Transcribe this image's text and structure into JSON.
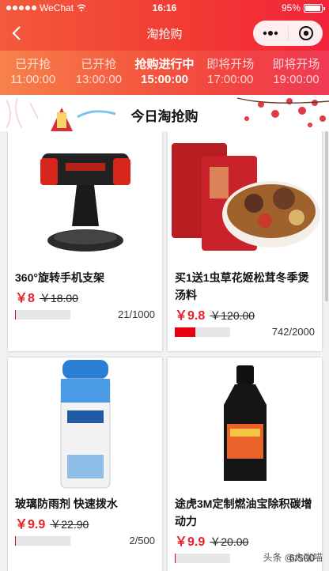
{
  "status_bar": {
    "carrier": "WeChat",
    "time": "16:16",
    "battery": "95%",
    "battery_level": 0.95
  },
  "nav": {
    "title": "淘抢购",
    "back_icon": "chevron-left-icon",
    "more_icon": "more-dots-icon",
    "close_icon": "target-icon"
  },
  "tabs": [
    {
      "name": "已开抢",
      "time": "11:00:00",
      "active": false
    },
    {
      "name": "已开抢",
      "time": "13:00:00",
      "active": false
    },
    {
      "name": "抢购进行中",
      "time": "15:00:00",
      "active": true
    },
    {
      "name": "即将开场",
      "time": "17:00:00",
      "active": false
    },
    {
      "name": "即将开场",
      "time": "19:00:00",
      "active": false
    }
  ],
  "banner": {
    "heading": "今日淘抢购"
  },
  "products": [
    {
      "name": "360°旋转手机支架",
      "price": "￥8",
      "orig": "￥18.00",
      "sold": 21,
      "total": 1000,
      "count": "21/1000",
      "image": "phone-holder-image"
    },
    {
      "name": "买1送1虫草花姬松茸冬季煲汤料",
      "price": "￥9.8",
      "orig": "￥120.00",
      "sold": 742,
      "total": 2000,
      "count": "742/2000",
      "image": "soup-pack-image"
    },
    {
      "name": "玻璃防雨剂 快速拨水",
      "price": "￥9.9",
      "orig": "￥22.90",
      "sold": 2,
      "total": 500,
      "count": "2/500",
      "image": "spray-can-image"
    },
    {
      "name": "途虎3M定制燃油宝除积碳增动力",
      "price": "￥9.9",
      "orig": "￥20.00",
      "sold": 6,
      "total": 500,
      "count": "6/500",
      "image": "fuel-bottle-image"
    }
  ],
  "watermark": "头条 @大咖喵",
  "colors": {
    "accent": "#e60012",
    "price": "#e8202a",
    "header_start": "#f35a3c",
    "header_end": "#f2233a"
  }
}
